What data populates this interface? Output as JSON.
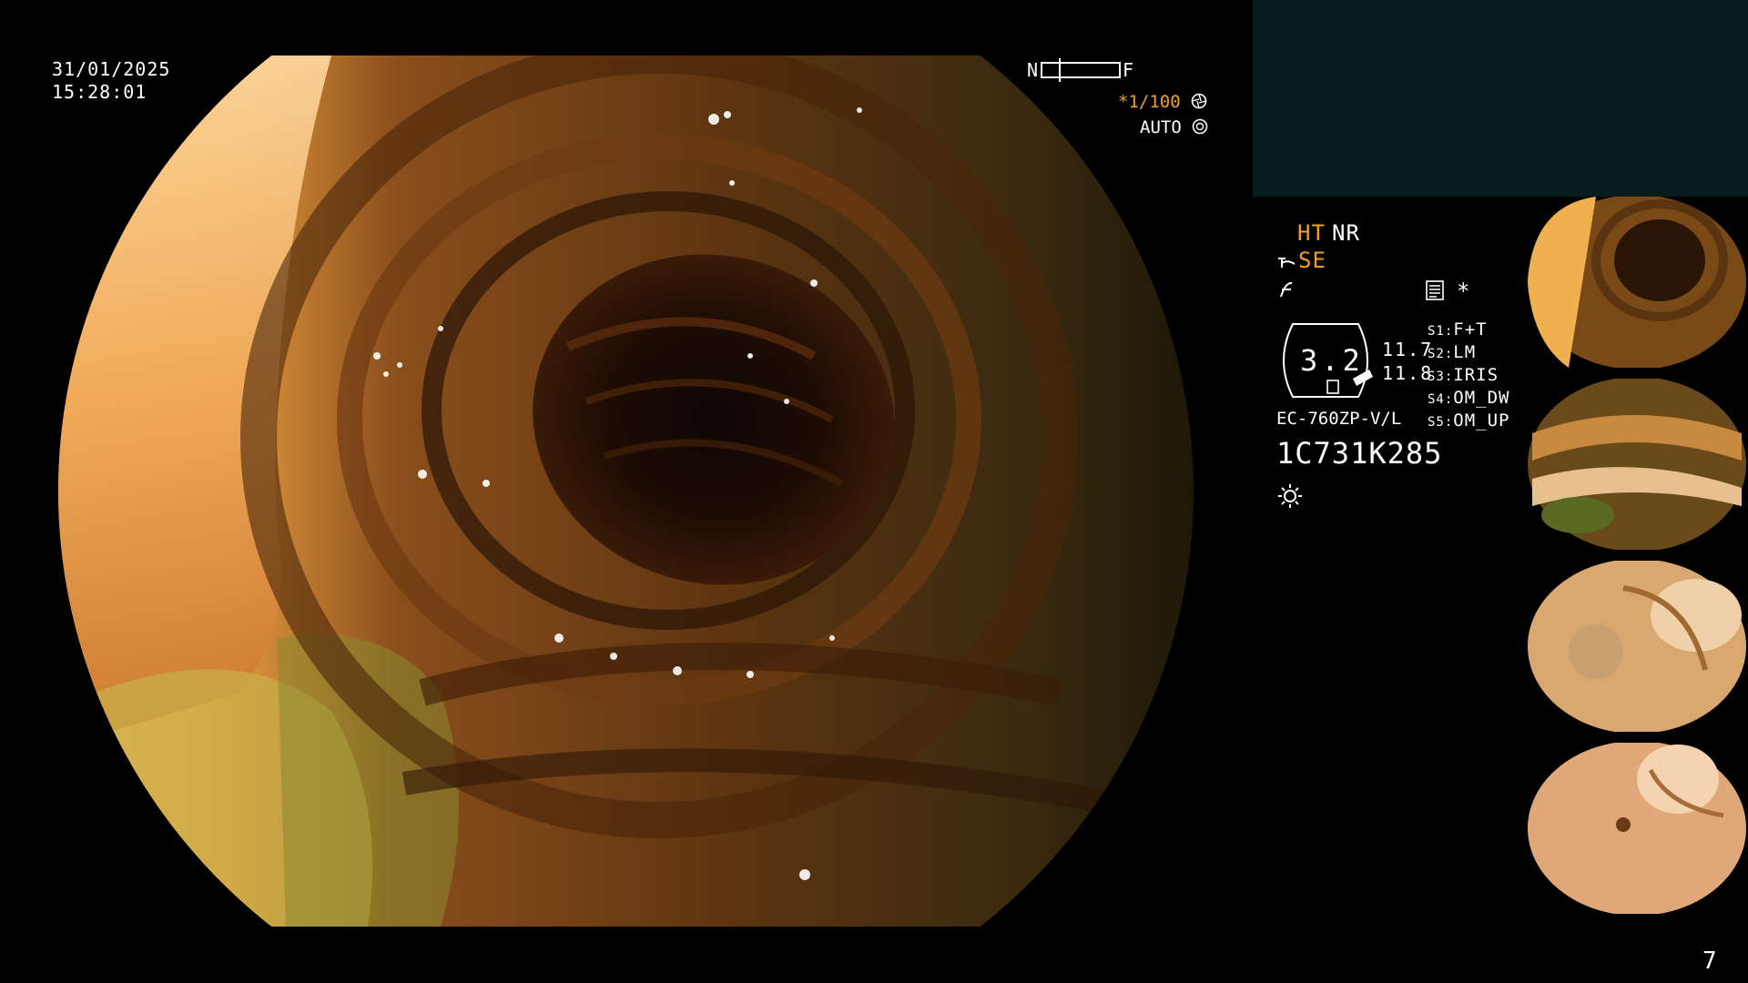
{
  "date": "31/01/2025",
  "time": "15:28:01",
  "focus": {
    "near_label": "N",
    "far_label": "F"
  },
  "shutter": "*1/100",
  "auto_label": "AUTO",
  "modes": {
    "ht": "HT",
    "nr": "NR",
    "se": "SE"
  },
  "zoom_value": "3.2",
  "readings": [
    "11.7",
    "11.8"
  ],
  "scope_model": "EC-760ZP-V/L",
  "serial": "1C731K285",
  "settings": [
    {
      "key": "S1:",
      "value": "F+T"
    },
    {
      "key": "S2:",
      "value": "LM"
    },
    {
      "key": "S3:",
      "value": "IRIS"
    },
    {
      "key": "S4:",
      "value": "OM_DW"
    },
    {
      "key": "S5:",
      "value": "OM_UP"
    }
  ],
  "page_number": "7",
  "colors": {
    "accent": "#f0a020",
    "panel": "#061d1c"
  }
}
